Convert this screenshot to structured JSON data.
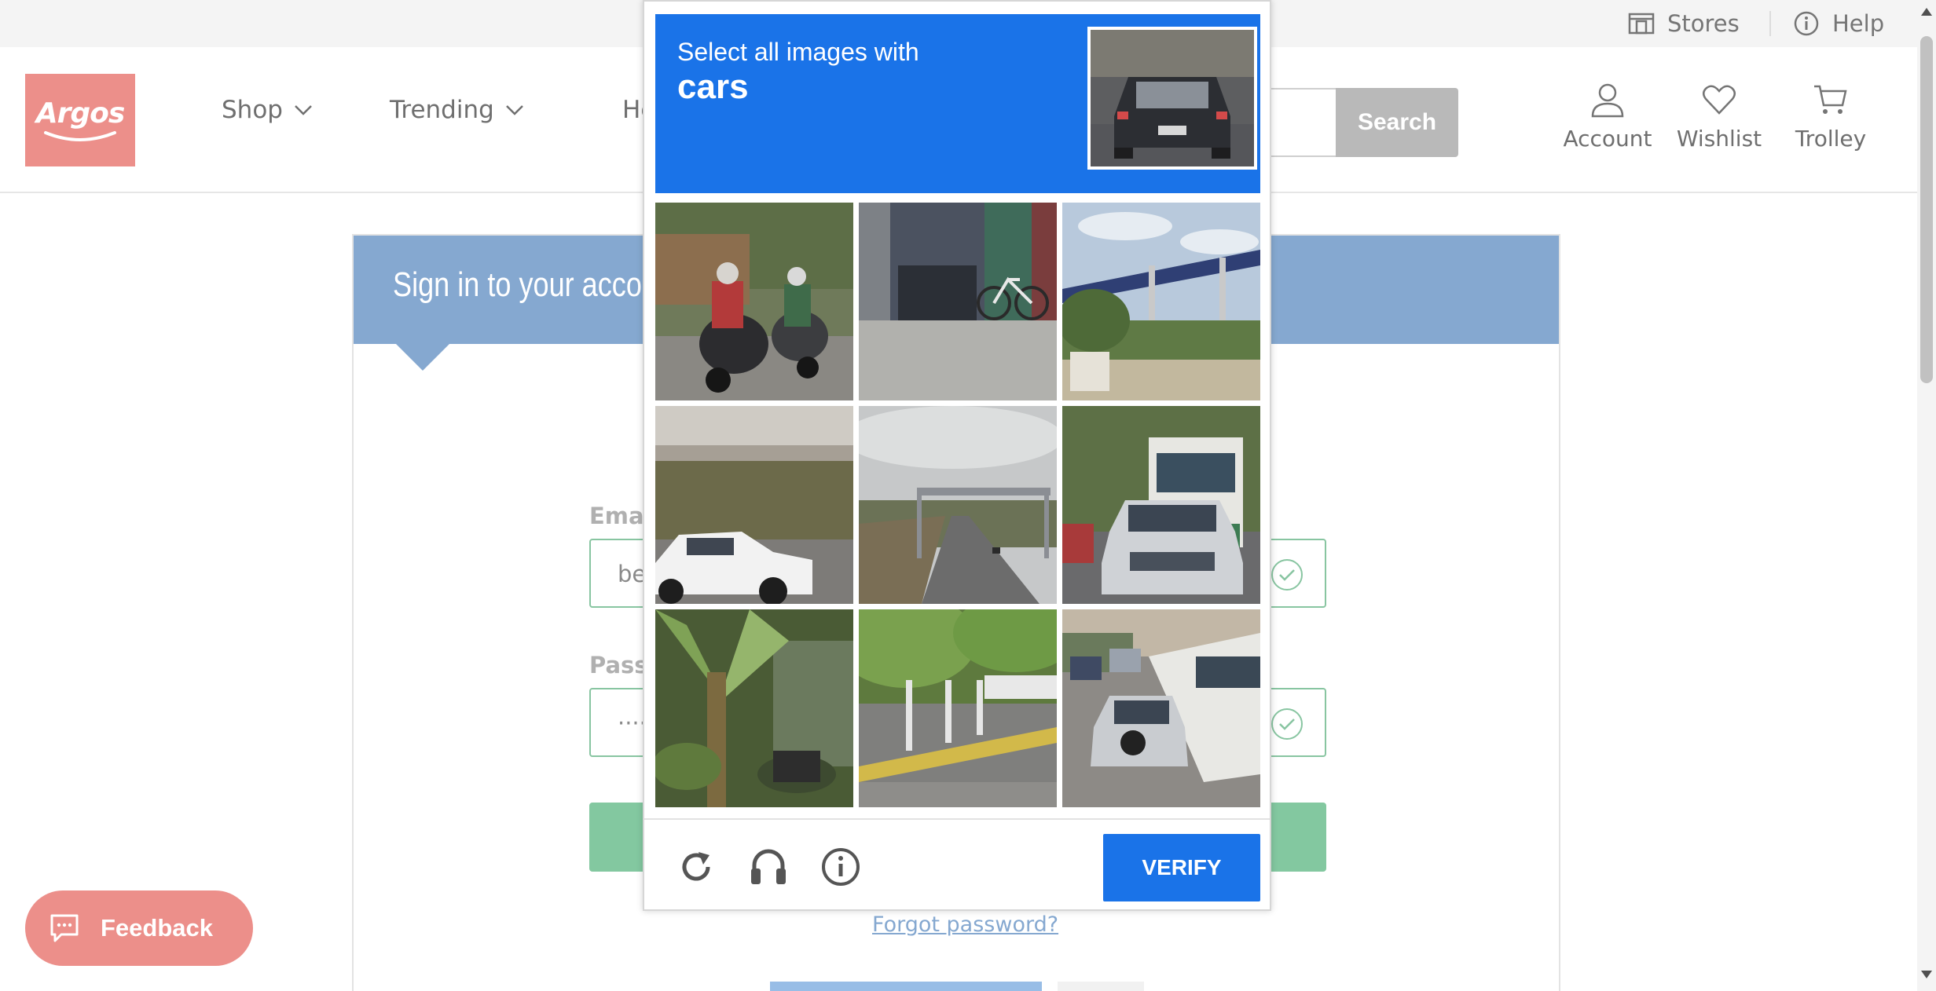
{
  "utility": {
    "stores_label": "Stores",
    "help_label": "Help"
  },
  "header": {
    "logo_text": "Argos",
    "nav": [
      {
        "label": "Shop"
      },
      {
        "label": "Trending"
      },
      {
        "label": "He"
      }
    ],
    "search_button": "Search",
    "account_label": "Account",
    "wishlist_label": "Wishlist",
    "trolley_label": "Trolley"
  },
  "signin": {
    "title": "Sign in to your accou",
    "email_label": "Emai",
    "email_value": "be",
    "password_label": "Passv",
    "password_value": "·····",
    "forgot_link": "Forgot password?"
  },
  "feedback": {
    "label": "Feedback"
  },
  "captcha": {
    "prompt": "Select all images with",
    "target": "cars",
    "verify_label": "VERIFY",
    "tiles": [
      {
        "icon": "street-scooters"
      },
      {
        "icon": "bicycle-wall"
      },
      {
        "icon": "highway-bridge"
      },
      {
        "icon": "white-car-underpass"
      },
      {
        "icon": "road-gantry"
      },
      {
        "icon": "suv-and-bus"
      },
      {
        "icon": "banana-tree"
      },
      {
        "icon": "tree-lined-street"
      },
      {
        "icon": "traffic-with-bus"
      }
    ]
  },
  "colors": {
    "brand": "#ec8f8a",
    "captcha_blue": "#1a73e8",
    "signin_header": "#85a8d0",
    "valid_green": "#88c5a1"
  }
}
